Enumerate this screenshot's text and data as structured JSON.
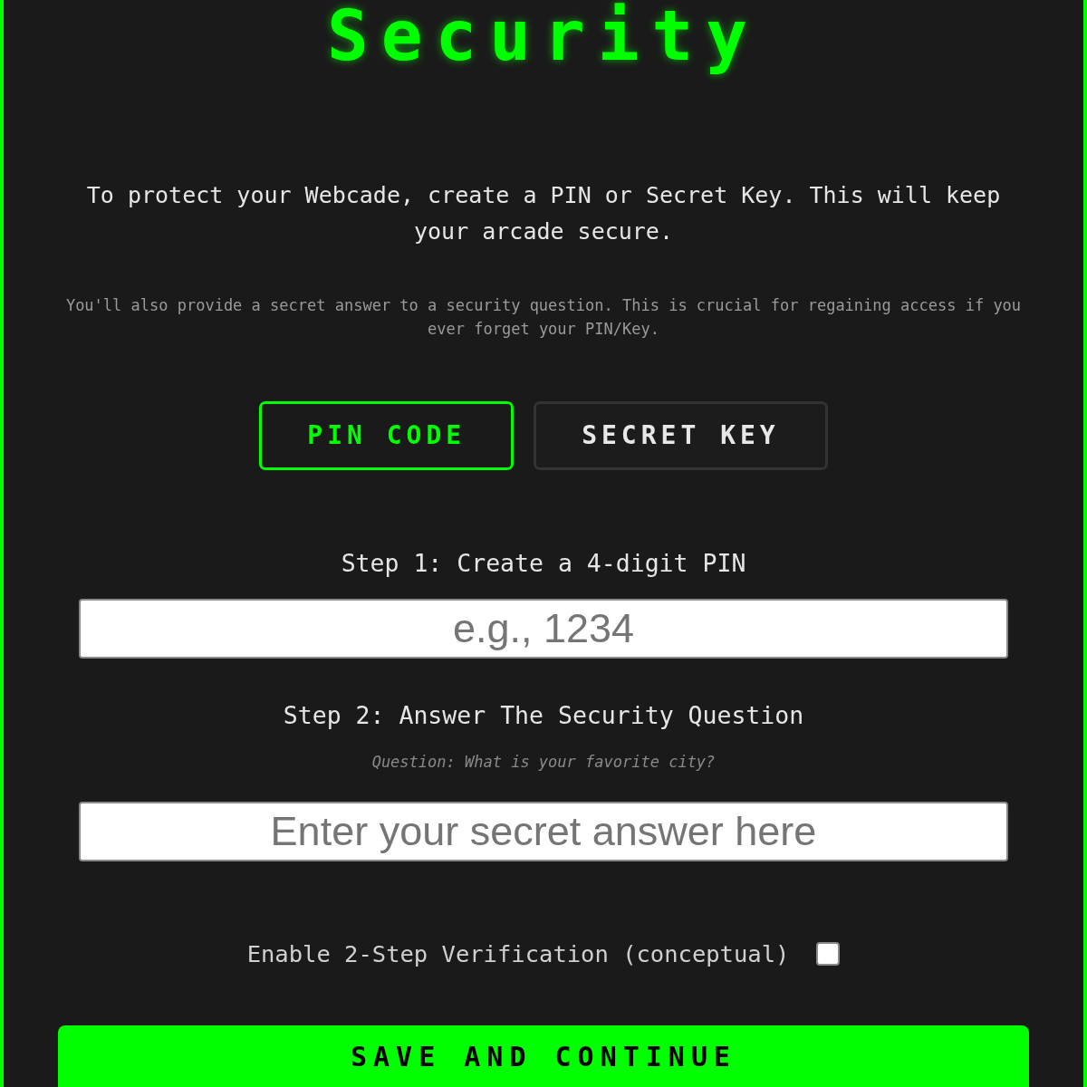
{
  "title": "Security",
  "intro": "To protect your Webcade, create a PIN or Secret Key. This will keep your arcade secure.",
  "note": "You'll also provide a secret answer to a security question. This is crucial for regaining access if you ever forget your PIN/Key.",
  "tabs": [
    {
      "label": "PIN CODE",
      "selected": true
    },
    {
      "label": "SECRET KEY",
      "selected": false
    }
  ],
  "steps": [
    {
      "label": "Step 1: Create a 4-digit PIN",
      "field": {
        "placeholder": "e.g., 1234"
      }
    },
    {
      "label": "Step 2: Answer The Security Question",
      "question": "Question: What is your favorite city?",
      "field": {
        "placeholder": "Enter your secret answer here"
      }
    }
  ],
  "two_step": {
    "label": "Enable 2-Step Verification (conceptual)",
    "checked": false
  },
  "save_button": "SAVE AND CONTINUE"
}
